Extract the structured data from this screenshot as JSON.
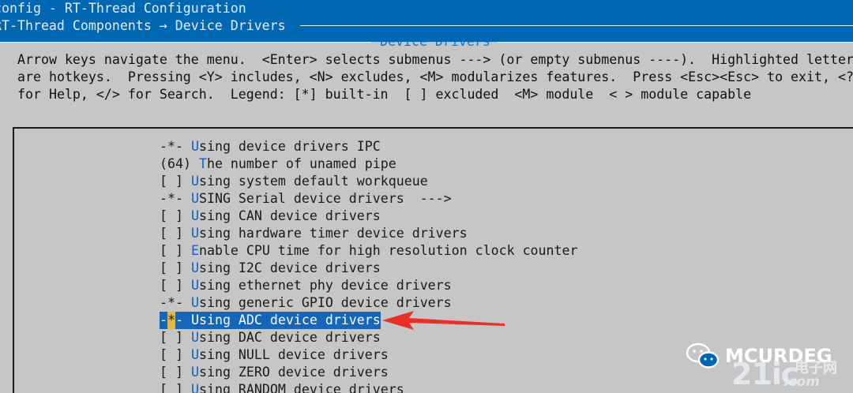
{
  "header": {
    "title": "config - RT-Thread Configuration",
    "breadcrumb": "RT-Thread Components → Device Drivers"
  },
  "dialog": {
    "title": "Device Drivers",
    "help_lines": [
      "Arrow keys navigate the menu.  <Enter> selects submenus ---> (or empty submenus ----).  Highlighted letters",
      "are hotkeys.  Pressing <Y> includes, <N> excludes, <M> modularizes features.  Press <Esc><Esc> to exit, <?>",
      "for Help, </> for Search.  Legend: [*] built-in  [ ] excluded  <M> module  < > module capable"
    ]
  },
  "menu": {
    "items": [
      {
        "prefix": "-*- ",
        "hot": "U",
        "rest": "sing device drivers IPC"
      },
      {
        "prefix": "(64) ",
        "hot": "T",
        "rest": "he number of unamed pipe"
      },
      {
        "prefix": "[ ] ",
        "hot": "U",
        "rest": "sing system default workqueue"
      },
      {
        "prefix": "-*- ",
        "hot": "U",
        "rest": "SING Serial device drivers  --->"
      },
      {
        "prefix": "[ ] ",
        "hot": "U",
        "rest": "sing CAN device drivers"
      },
      {
        "prefix": "[ ] ",
        "hot": "U",
        "rest": "sing hardware timer device drivers"
      },
      {
        "prefix": "[ ] ",
        "hot": "E",
        "rest": "nable CPU time for high resolution clock counter"
      },
      {
        "prefix": "[ ] ",
        "hot": "U",
        "rest": "sing I2C device drivers"
      },
      {
        "prefix": "[ ] ",
        "hot": "U",
        "rest": "sing ethernet phy device drivers"
      },
      {
        "prefix": "-*- ",
        "hot": "U",
        "rest": "sing generic GPIO device drivers"
      },
      {
        "pre": "-",
        "star": "*",
        "post": "- ",
        "hot": "U",
        "rest": "sing ADC device drivers"
      },
      {
        "prefix": "[ ] ",
        "hot": "U",
        "rest": "sing DAC device drivers"
      },
      {
        "prefix": "[ ] ",
        "hot": "U",
        "rest": "sing NULL device drivers"
      },
      {
        "prefix": "[ ] ",
        "hot": "U",
        "rest": "sing ZERO device drivers"
      },
      {
        "prefix": "[ ] ",
        "hot": "U",
        "rest": "sing RANDOM device drivers"
      }
    ]
  },
  "watermark": {
    "wechat_name": "MCURDEG",
    "site_logo": "21ic",
    "site_cn": "电子网",
    "site_domain": ".com"
  },
  "colors": {
    "background": "#0067b3",
    "dialog": "#c6c6c6",
    "hotkey": "#1360c8",
    "selection": "#1565b8",
    "star_highlight": "#e0b93c",
    "annotation_arrow": "#e8302a"
  }
}
